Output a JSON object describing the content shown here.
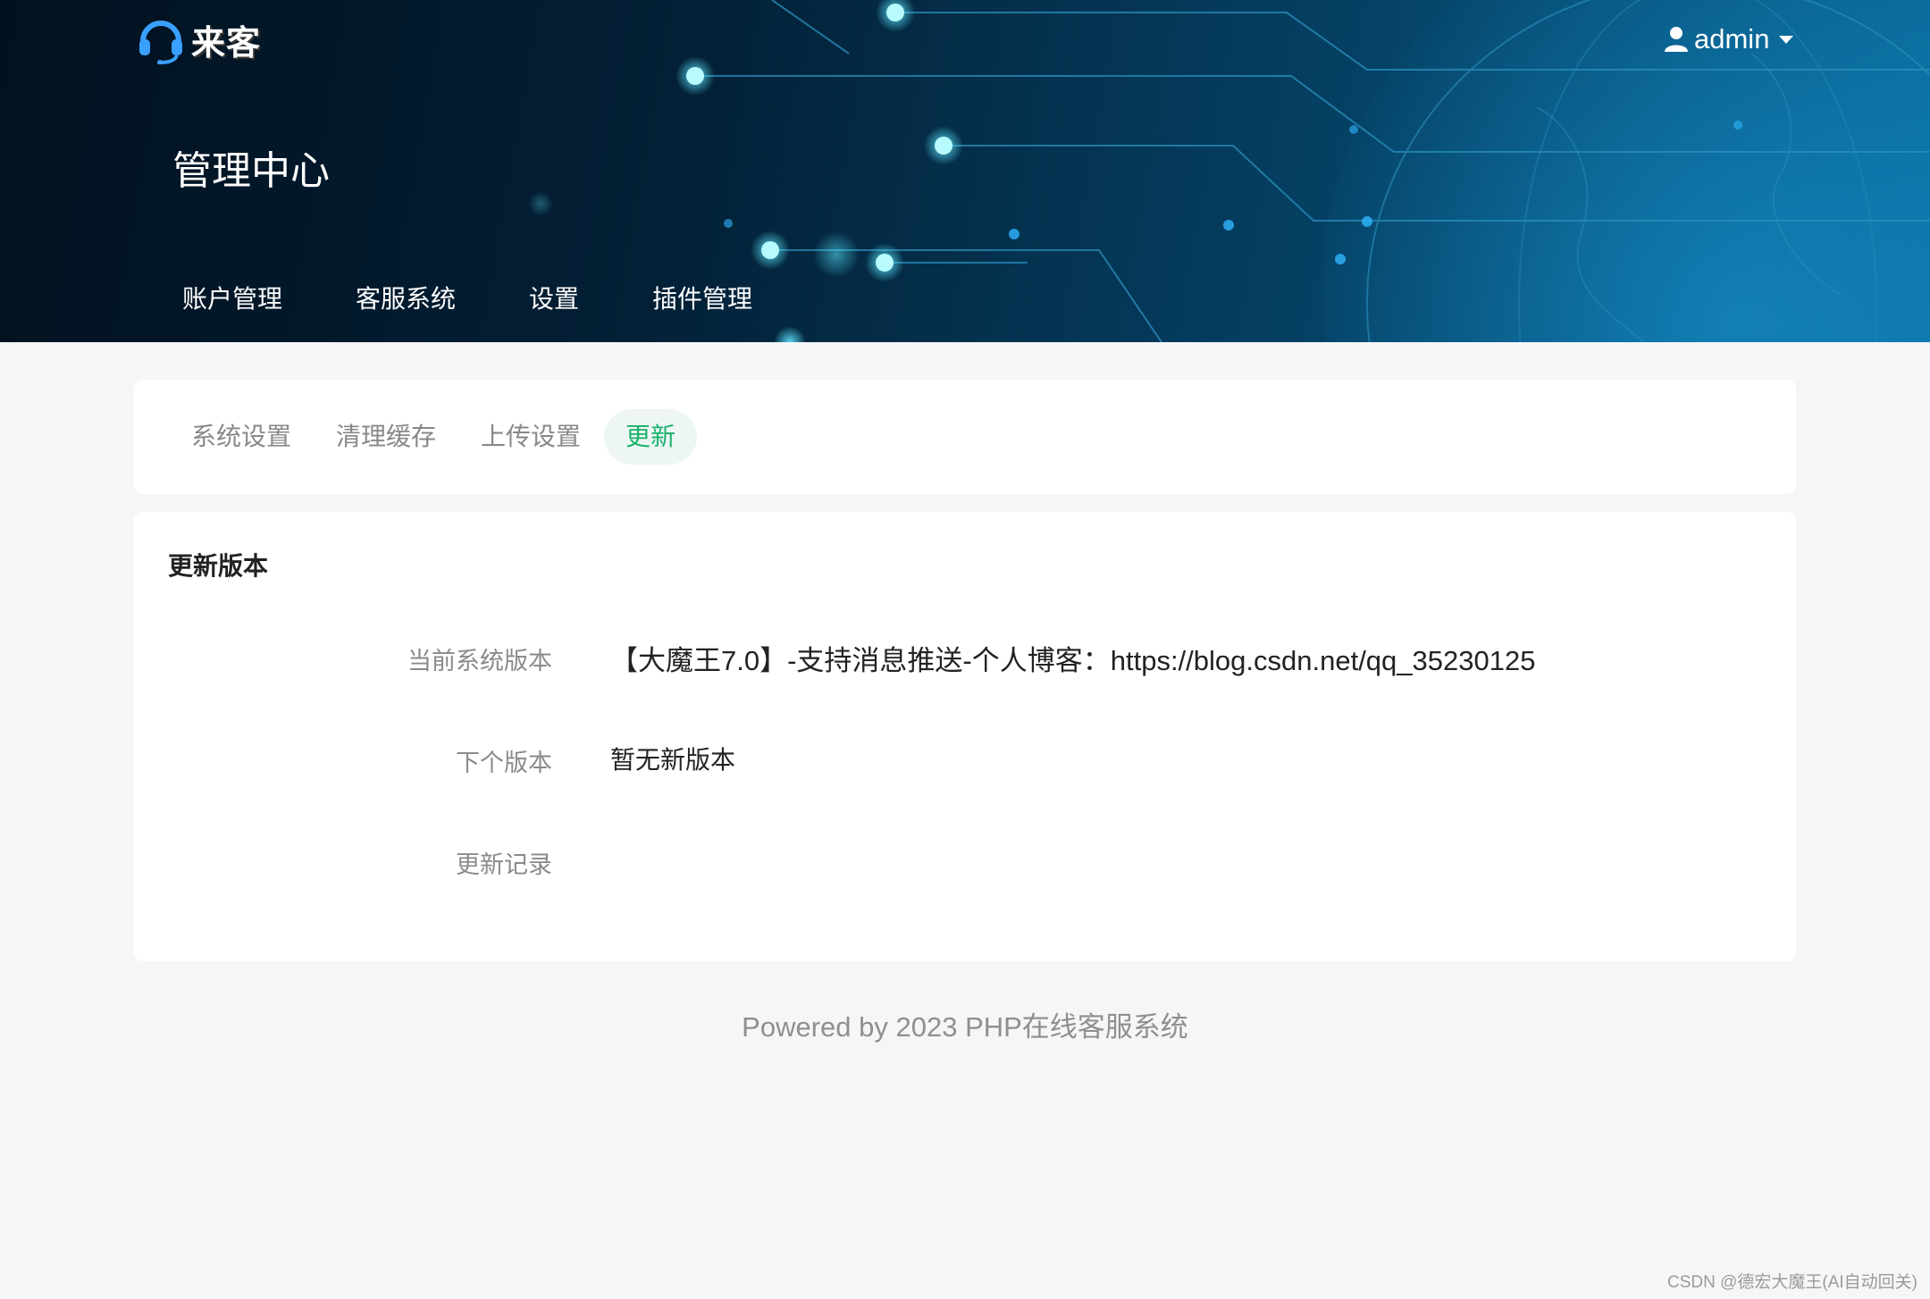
{
  "brand": {
    "name": "来客"
  },
  "user": {
    "name": "admin"
  },
  "header": {
    "title": "管理中心"
  },
  "top_nav": [
    {
      "label": "账户管理"
    },
    {
      "label": "客服系统"
    },
    {
      "label": "设置"
    },
    {
      "label": "插件管理"
    }
  ],
  "tabs": [
    {
      "label": "系统设置",
      "active": false
    },
    {
      "label": "清理缓存",
      "active": false
    },
    {
      "label": "上传设置",
      "active": false
    },
    {
      "label": "更新",
      "active": true
    }
  ],
  "section": {
    "title": "更新版本",
    "rows": [
      {
        "label": "当前系统版本",
        "value": "【大魔王7.0】-支持消息推送-个人博客：https://blog.csdn.net/qq_35230125"
      },
      {
        "label": "下个版本",
        "value": "暂无新版本"
      },
      {
        "label": "更新记录",
        "value": ""
      }
    ]
  },
  "footer": {
    "text": "Powered by 2023 PHP在线客服系统"
  },
  "watermark": {
    "text": "CSDN @德宏大魔王(AI自动回关)"
  },
  "colors": {
    "header_dark": "#02111f",
    "header_light": "#0a6d9e",
    "accent_green": "#19b36b",
    "page_bg": "#f5f6f8",
    "icon_blue": "#3aa0ff"
  },
  "icons": {
    "logo": "headset-icon",
    "user": "user-icon",
    "dropdown": "caret-down-icon"
  }
}
